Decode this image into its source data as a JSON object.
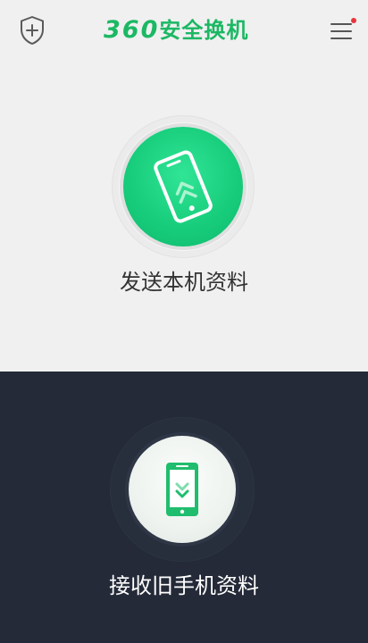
{
  "header": {
    "title_digits": "360",
    "title_text": "安全换机",
    "shield_icon": "shield-plus-icon",
    "menu_icon": "hamburger-menu-icon",
    "notification_dot_color": "#e8353a"
  },
  "send": {
    "label": "发送本机资料",
    "icon": "phone-upload-icon",
    "accent_color": "#16cc7a"
  },
  "receive": {
    "label": "接收旧手机资料",
    "icon": "phone-download-icon",
    "accent_color": "#1cb864"
  },
  "colors": {
    "top_background": "#f0f0f0",
    "bottom_background": "#242a38",
    "brand_green": "#1cb864"
  }
}
